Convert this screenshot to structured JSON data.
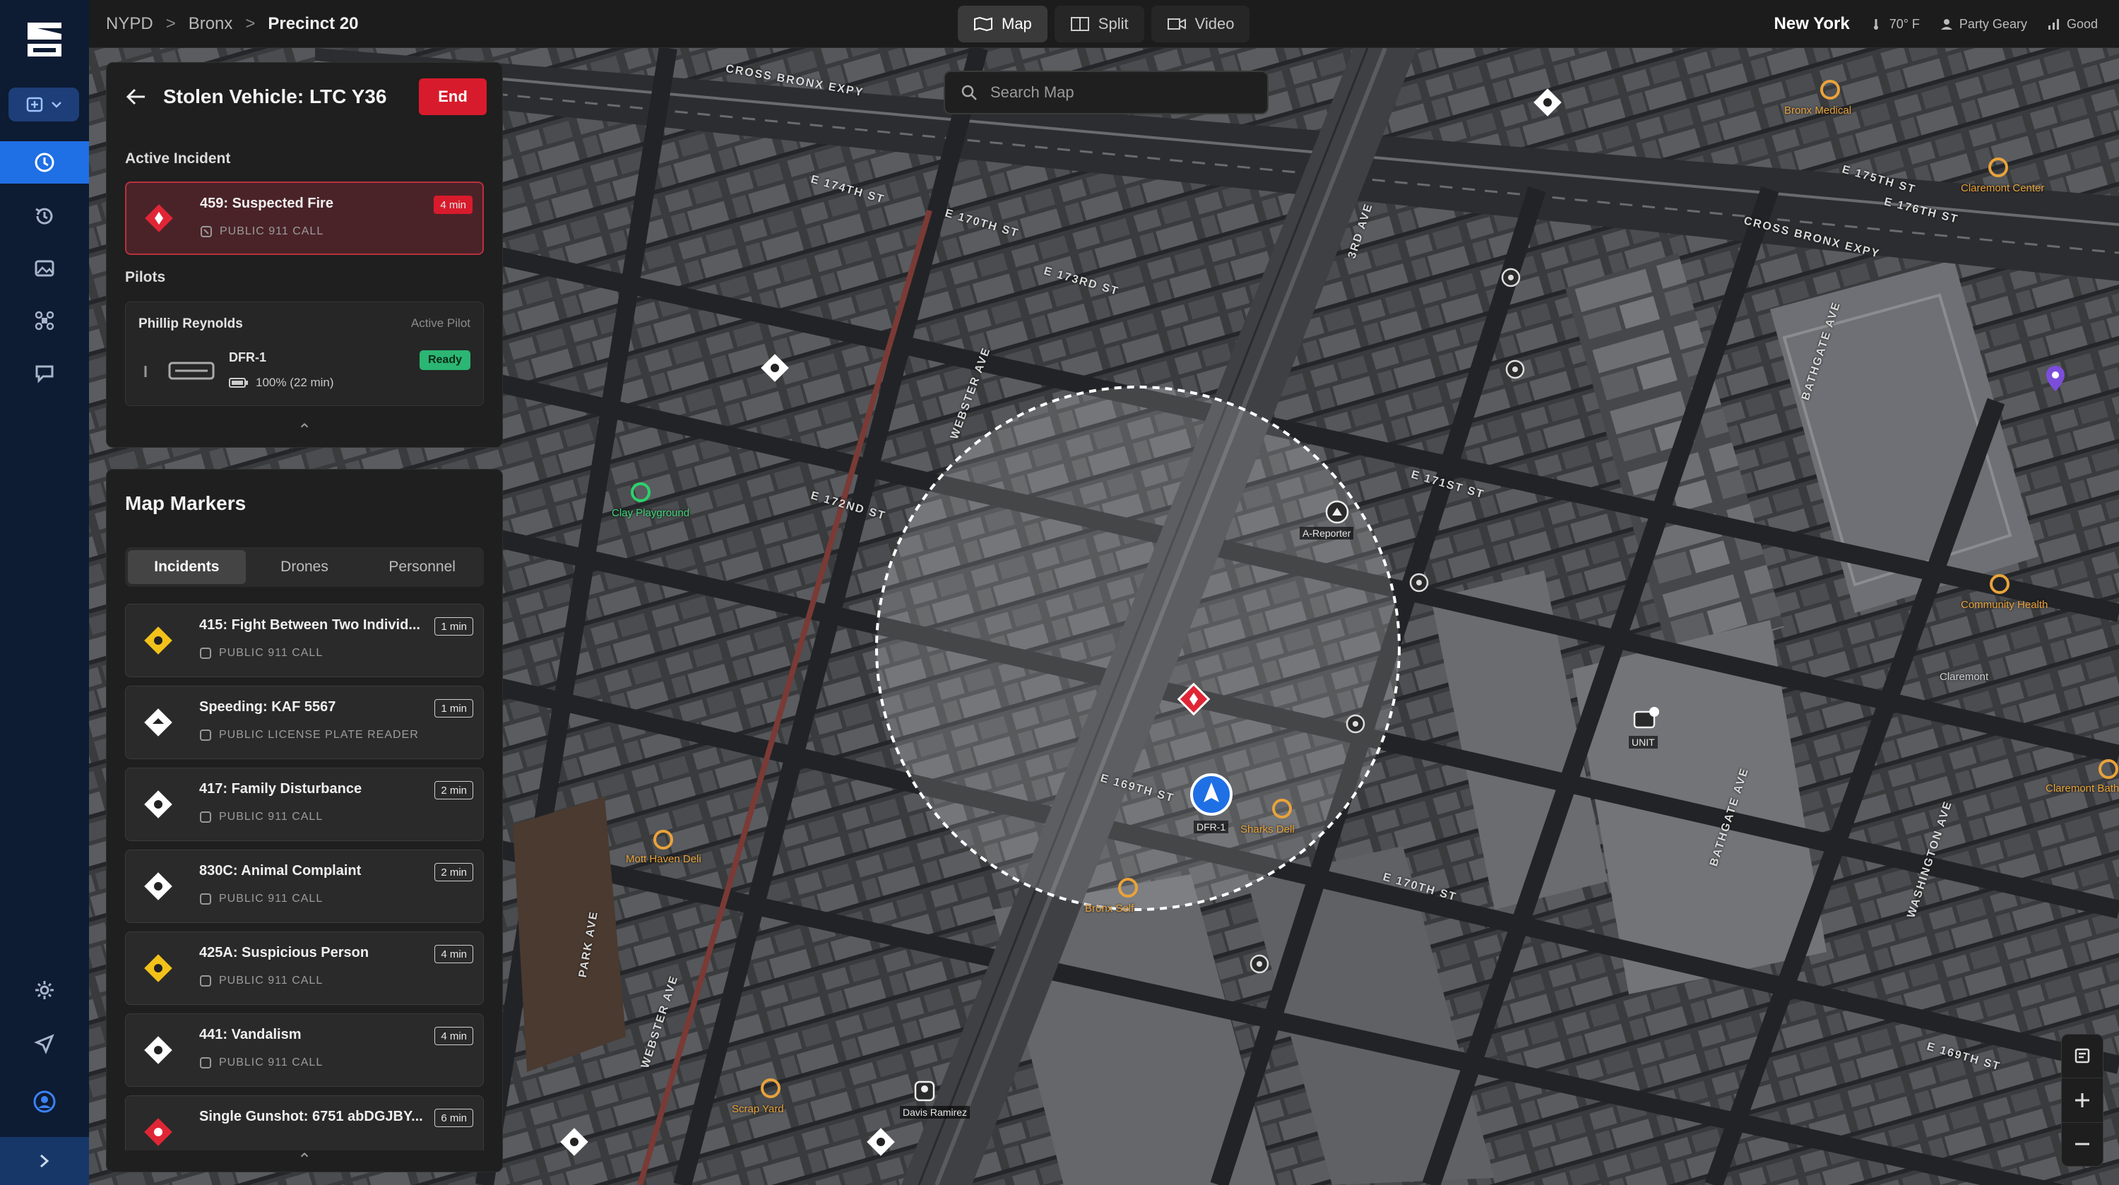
{
  "breadcrumb": [
    "NYPD",
    "Bronx",
    "Precinct 20"
  ],
  "view_tabs": [
    {
      "label": "Map",
      "icon": "map-icon",
      "active": true
    },
    {
      "label": "Split",
      "icon": "split-icon",
      "active": false
    },
    {
      "label": "Video",
      "icon": "video-icon",
      "active": false
    }
  ],
  "status": {
    "city": "New York",
    "weather": "70° F",
    "user": "Party Geary",
    "signal": "Good"
  },
  "search": {
    "placeholder": "Search Map"
  },
  "incident_panel": {
    "title": "Stolen Vehicle: LTC Y36",
    "end_label": "End",
    "active_incident_label": "Active Incident",
    "active_incident": {
      "title": "459: Suspected Fire",
      "source": "PUBLIC 911 CALL",
      "age": "4 min"
    },
    "pilots_label": "Pilots",
    "pilot": {
      "name": "Phillip Reynolds",
      "status": "Active Pilot",
      "drone": "DFR-1",
      "battery": "100% (22 min)",
      "ready_label": "Ready"
    }
  },
  "markers_panel": {
    "title": "Map Markers",
    "tabs": [
      {
        "label": "Incidents",
        "active": true
      },
      {
        "label": "Drones",
        "active": false
      },
      {
        "label": "Personnel",
        "active": false
      }
    ],
    "incidents": [
      {
        "title": "415: Fight Between Two Individ...",
        "source": "PUBLIC 911 CALL",
        "age": "1 min",
        "color": "#f2c21b"
      },
      {
        "title": "Speeding: KAF 5567",
        "source": "PUBLIC LICENSE PLATE READER",
        "age": "1 min",
        "color": "#ffffff"
      },
      {
        "title": "417: Family Disturbance",
        "source": "PUBLIC 911 CALL",
        "age": "2 min",
        "color": "#ffffff"
      },
      {
        "title": "830C: Animal Complaint",
        "source": "PUBLIC 911 CALL",
        "age": "2 min",
        "color": "#ffffff"
      },
      {
        "title": "425A: Suspicious Person",
        "source": "PUBLIC 911 CALL",
        "age": "4 min",
        "color": "#f2c21b"
      },
      {
        "title": "441: Vandalism",
        "source": "PUBLIC 911 CALL",
        "age": "4 min",
        "color": "#ffffff"
      },
      {
        "title": "Single Gunshot: 6751 abDGJBY...",
        "source": "",
        "age": "6 min",
        "color": "#e02636"
      }
    ]
  },
  "map_labels": {
    "streets": [
      "CROSS BRONX EXPY",
      "E 174TH ST",
      "E 173RD ST",
      "E 172ND ST",
      "E 171ST ST",
      "WEBSTER AVE",
      "E 175TH ST",
      "CROSS BRONX EXPY",
      "E 176TH ST",
      "BATHGATE AVE",
      "E 170TH ST",
      "WEBSTER AVE",
      "E 169TH ST",
      "PARK AVE",
      "E 170TH ST",
      "E 169TH ST",
      "BATHGATE AVE",
      "3RD AVE",
      "WASHINGTON AVE"
    ],
    "pois": [
      "Clay Playground",
      "Bronx Medical",
      "Claremont Center",
      "Community Health",
      "Mott Haven Deli",
      "Sharks Dell",
      "Bronx Self",
      "Scrap Yard",
      "Claremont Bath",
      "Claremont"
    ],
    "drone_label": "DFR-1",
    "camera_label": "A-Reporter",
    "unit_label": "UNIT",
    "person_label": "Davis Ramirez"
  },
  "colors": {
    "accent": "#1f6fe5",
    "danger": "#d81b2c",
    "ready": "#2bb673",
    "warning": "#f2c21b"
  }
}
